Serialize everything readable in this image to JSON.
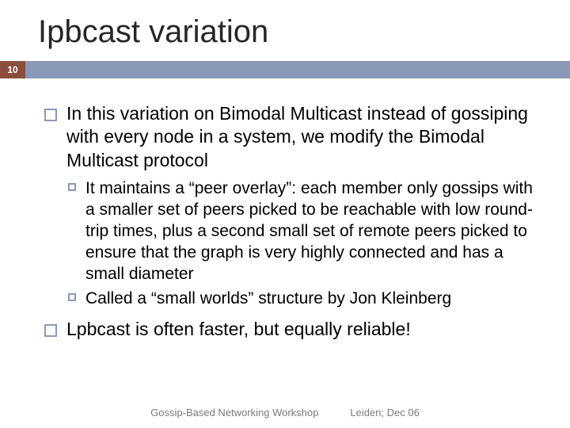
{
  "slide": {
    "title": "Ipbcast variation",
    "page_number": "10",
    "bullets": {
      "b1": "In this variation on Bimodal Multicast instead of gossiping with every node in a system, we modify the Bimodal Multicast protocol",
      "b1a": "It maintains a “peer overlay”: each member only gossips with a smaller set of peers picked to be reachable with low round-trip times, plus a second small set of remote peers picked to ensure that the graph is very highly connected and has a small diameter",
      "b1b": "Called a “small worlds” structure by Jon Kleinberg",
      "b2": "Lpbcast is often faster, but equally reliable!"
    }
  },
  "footer": {
    "left": "Gossip-Based Networking Workshop",
    "right": "Leiden; Dec 06"
  },
  "colors": {
    "accent_bar": "#8a99b8",
    "badge": "#8b4e3d"
  }
}
